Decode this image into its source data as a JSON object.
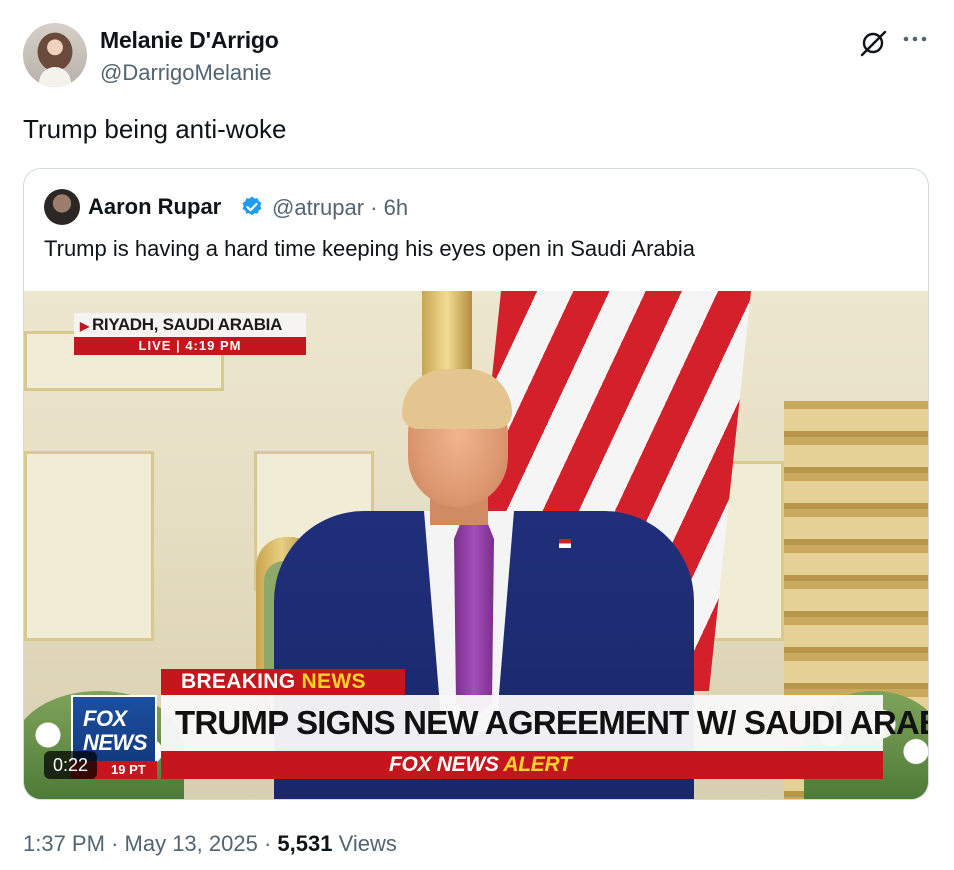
{
  "tweet": {
    "author_name": "Melanie D'Arrigo",
    "author_handle": "@DarrigoMelanie",
    "text": "Trump being anti-woke",
    "time": "1:37 PM",
    "separator": "·",
    "date": "May 13, 2025",
    "views_count": "5,531",
    "views_label": "Views"
  },
  "quote": {
    "author_name": "Aaron Rupar",
    "author_handle": "@atrupar",
    "separator": "·",
    "age": "6h",
    "text": "Trump is having a hard time keeping his eyes open in Saudi Arabia"
  },
  "video": {
    "location": "RIYADH, SAUDI ARABIA",
    "live_label": "LIVE",
    "live_time": "4:19 PM",
    "breaking_word": "BREAKING",
    "breaking_accent": "NEWS",
    "headline": "TRUMP SIGNS NEW AGREEMENT W/ SAUDI ARABIA",
    "alert_brand": "FOX NEWS",
    "alert_accent": "ALERT",
    "logo_line1": "FOX",
    "logo_line2": "NEWS",
    "logo_time": "19 PT",
    "duration": "0:22"
  },
  "icons": {
    "grok": "grok-icon",
    "more": "more-icon",
    "verified": "verified-badge-icon"
  },
  "colors": {
    "text_primary": "#0f1419",
    "text_secondary": "#536471",
    "border": "#cfd9de",
    "verified_blue": "#1d9bf0",
    "fox_red": "#c4161c",
    "fox_yellow": "#ffd42a"
  }
}
